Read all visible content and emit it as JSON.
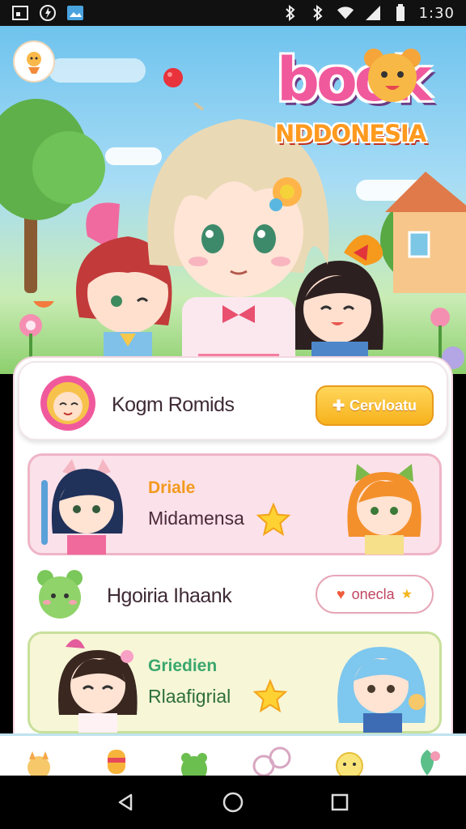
{
  "status_bar": {
    "time": "1:30",
    "left_icons": [
      "gallery-icon",
      "speed-icon",
      "image-icon"
    ],
    "right_icons": [
      "bluetooth-icon",
      "bluetooth-icon",
      "wifi-icon",
      "signal-icon",
      "battery-icon"
    ]
  },
  "hero": {
    "logo_word": "book",
    "logo_sub": "NDDONESIA"
  },
  "user_card": {
    "name": "Kogm Romids",
    "button_label": "Cervloatu"
  },
  "pink_card": {
    "line1": "Driale",
    "line2": "Midamensa",
    "title_color": "#f29a1d"
  },
  "plain_row": {
    "name": "Hgoiria Ihaank",
    "button_label": "onecla"
  },
  "green_card": {
    "line1": "Griedien",
    "line2": "Rlaafigrial",
    "title_color": "#3aa76d"
  },
  "bottom_tabs": [
    "tab-character-1",
    "tab-candy",
    "tab-frog",
    "tab-flower",
    "tab-sticker",
    "tab-leaf"
  ],
  "nav": [
    "back-icon",
    "home-icon",
    "recents-icon"
  ],
  "colors": {
    "accent_yellow": "#f7b21c",
    "accent_pink": "#eeb5c6",
    "panel_border": "#f3d6df"
  }
}
